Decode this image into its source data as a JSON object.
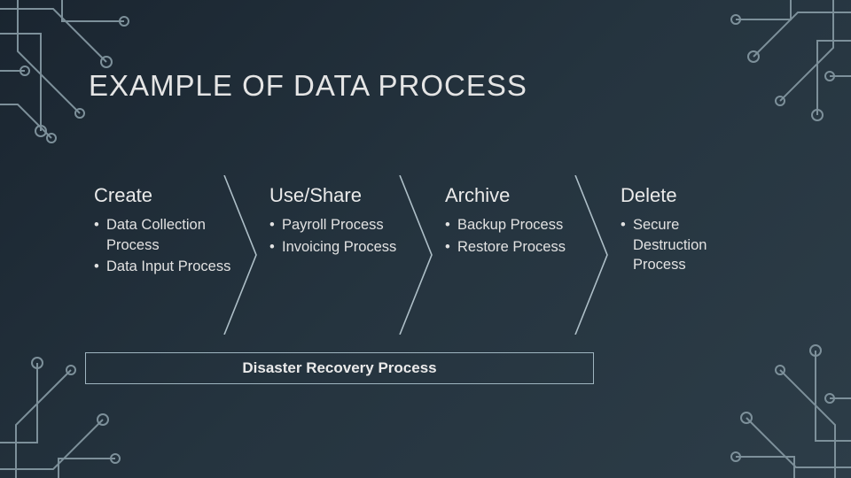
{
  "title": "EXAMPLE OF DATA PROCESS",
  "stages": [
    {
      "heading": "Create",
      "items": [
        "Data Collection Process",
        "Data Input Process"
      ]
    },
    {
      "heading": "Use/Share",
      "items": [
        "Payroll Process",
        "Invoicing Process"
      ]
    },
    {
      "heading": "Archive",
      "items": [
        "Backup Process",
        "Restore Process"
      ]
    },
    {
      "heading": "Delete",
      "items": [
        "Secure Destruction Process"
      ]
    }
  ],
  "underbox": "Disaster Recovery Process",
  "colors": {
    "outline": "#aebfc8"
  }
}
